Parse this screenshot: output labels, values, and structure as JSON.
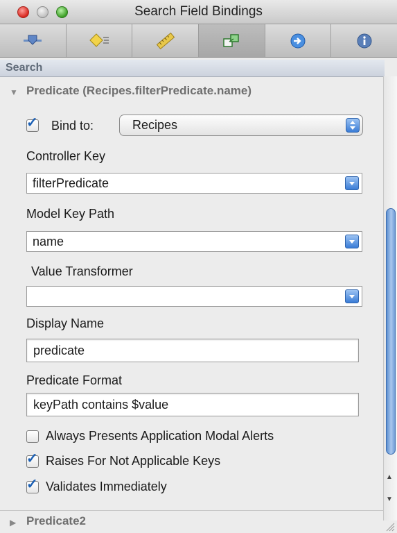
{
  "window": {
    "title": "Search Field Bindings"
  },
  "toolbar": {
    "tabs": [
      {
        "icon": "attributes-icon"
      },
      {
        "icon": "effects-icon"
      },
      {
        "icon": "size-icon"
      },
      {
        "icon": "bindings-icon",
        "active": true
      },
      {
        "icon": "connections-icon"
      },
      {
        "icon": "info-icon"
      }
    ]
  },
  "section": {
    "title": "Search"
  },
  "predicate": {
    "title": "Predicate (Recipes.filterPredicate.name)",
    "bind_to_label": "Bind to:",
    "bind_to_checked": true,
    "bind_to_value": "Recipes",
    "controller_key_label": "Controller Key",
    "controller_key_value": "filterPredicate",
    "model_key_path_label": "Model Key Path",
    "model_key_path_value": "name",
    "value_transformer_label": "Value Transformer",
    "value_transformer_value": "",
    "display_name_label": "Display Name",
    "display_name_value": "predicate",
    "predicate_format_label": "Predicate Format",
    "predicate_format_value": "keyPath contains $value",
    "options": [
      {
        "label": "Always Presents Application Modal Alerts",
        "checked": false
      },
      {
        "label": "Raises For Not Applicable Keys",
        "checked": true
      },
      {
        "label": "Validates Immediately",
        "checked": true
      }
    ]
  },
  "predicate2": {
    "title": "Predicate2"
  },
  "colors": {
    "accent": "#3a7cd6",
    "section_text": "#5f6a78"
  }
}
